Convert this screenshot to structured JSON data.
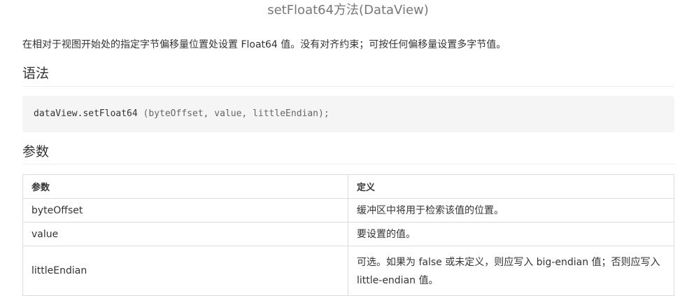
{
  "page": {
    "title": "setFloat64方法(DataView)",
    "intro": "在相对于视图开始处的指定字节偏移量位置处设置 Float64 值。没有对齐约束；可按任何偏移量设置多字节值。"
  },
  "syntax": {
    "heading": "语法",
    "code_prefix": "dataView.setFloat64 ",
    "code_args": "(byteOffset, value, littleEndian);"
  },
  "parameters": {
    "heading": "参数",
    "columns": [
      "参数",
      "定义"
    ],
    "rows": [
      {
        "name": "byteOffset",
        "definition": "缓冲区中将用于检索该值的位置。"
      },
      {
        "name": "value",
        "definition": "要设置的值。"
      },
      {
        "name": "littleEndian",
        "definition": "可选。如果为 false 或未定义，则应写入 big-endian 值；否则应写入 little-endian 值。"
      }
    ]
  },
  "colors": {
    "title": "#777777",
    "text": "#333333",
    "code_background": "#f5f5f5",
    "table_border": "#dddddd"
  }
}
